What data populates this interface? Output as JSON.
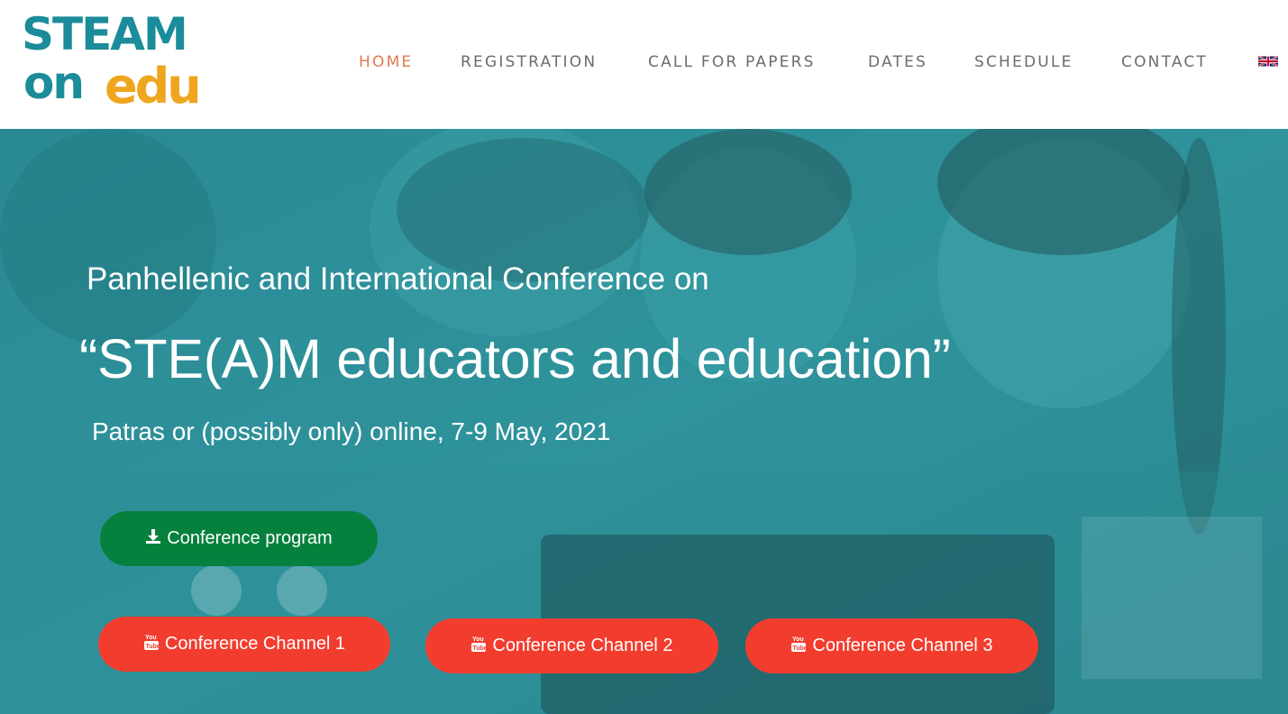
{
  "logo": {
    "line1": "STEAM",
    "line2": "on",
    "line3": "edu"
  },
  "nav": {
    "items": [
      {
        "label": "HOME",
        "active": true
      },
      {
        "label": "REGISTRATION",
        "active": false
      },
      {
        "label": "CALL FOR PAPERS",
        "active": false
      },
      {
        "label": "DATES",
        "active": false
      },
      {
        "label": "SCHEDULE",
        "active": false
      },
      {
        "label": "CONTACT",
        "active": false
      }
    ],
    "language_icon": "uk-flag-icon"
  },
  "hero": {
    "subtitle": "Panhellenic and International Conference on",
    "title": "“STE(A)M educators and education”",
    "date_line": "Patras or (possibly only) online, 7-9 May, 2021",
    "buttons": {
      "program": {
        "label": "Conference program",
        "icon": "download-icon"
      },
      "channel1": {
        "label": "Conference Channel 1",
        "icon": "youtube-icon"
      },
      "channel2": {
        "label": "Conference Channel 2",
        "icon": "youtube-icon"
      },
      "channel3": {
        "label": "Conference Channel 3",
        "icon": "youtube-icon"
      }
    }
  },
  "colors": {
    "logo_teal": "#1b8c99",
    "logo_orange": "#f0a51f",
    "nav_active": "#e07b4f",
    "nav_text": "#6a6c72",
    "hero_overlay": "#2e8f98",
    "program_button": "#06803d",
    "channel_button": "#f23d2e"
  }
}
